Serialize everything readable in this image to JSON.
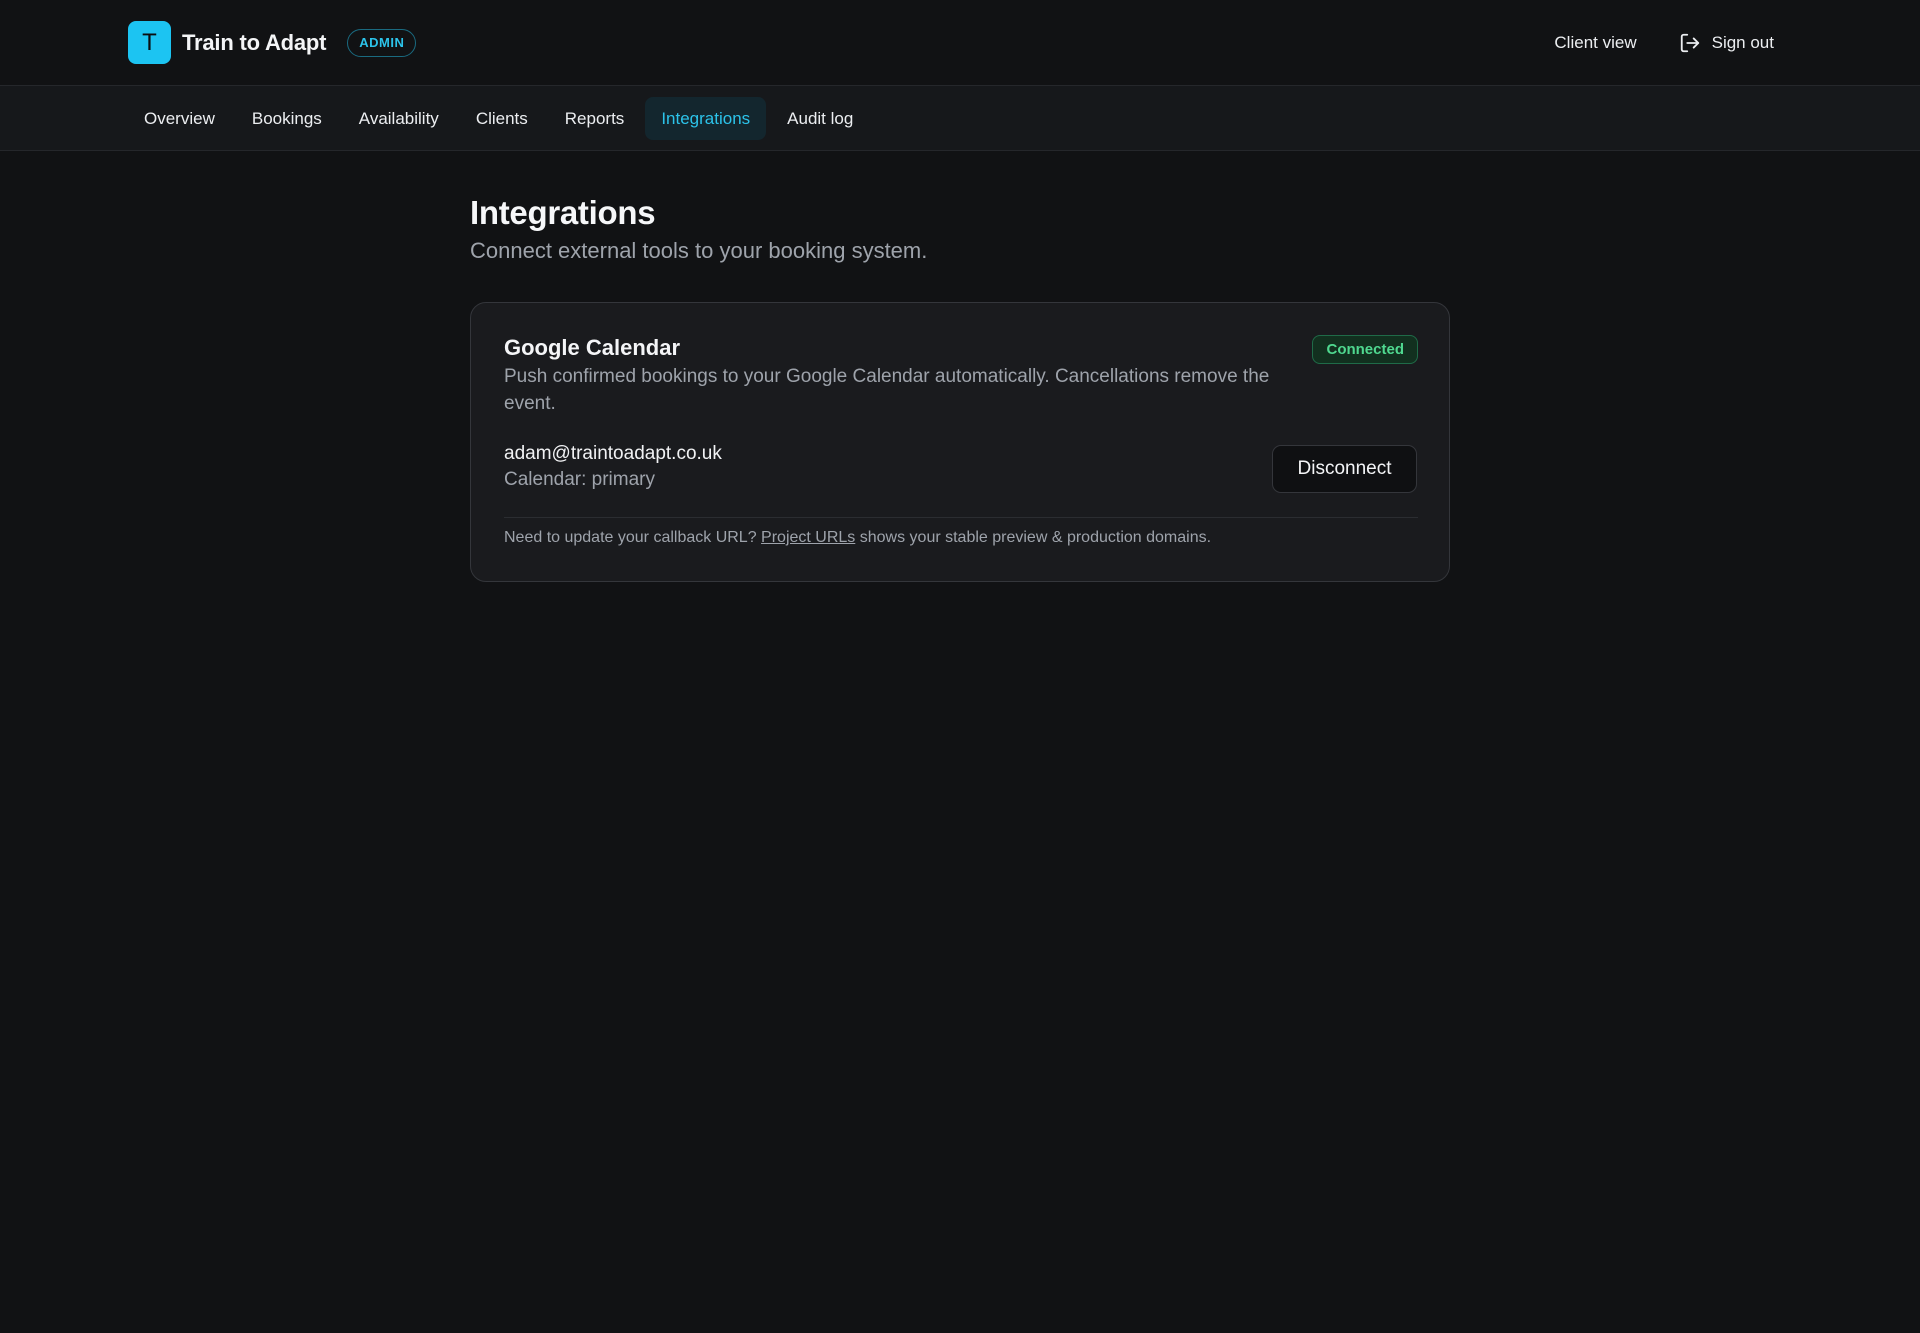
{
  "header": {
    "logo_letter": "T",
    "brand_name": "Train to Adapt",
    "role_badge": "ADMIN",
    "client_view": "Client view",
    "sign_out": "Sign out"
  },
  "nav": {
    "tabs": [
      {
        "label": "Overview"
      },
      {
        "label": "Bookings"
      },
      {
        "label": "Availability"
      },
      {
        "label": "Clients"
      },
      {
        "label": "Reports"
      },
      {
        "label": "Integrations"
      },
      {
        "label": "Audit log"
      }
    ],
    "active": "Integrations"
  },
  "page": {
    "title": "Integrations",
    "subtitle": "Connect external tools to your booking system."
  },
  "integration": {
    "name": "Google Calendar",
    "description": "Push confirmed bookings to your Google Calendar automatically. Cancellations remove the event.",
    "status": "Connected",
    "account_email": "adam@traintoadapt.co.uk",
    "calendar": "Calendar: primary",
    "disconnect_label": "Disconnect",
    "footnote_before": "Need to update your callback URL? ",
    "footnote_link": "Project URLs",
    "footnote_after": " shows your stable preview & production domains."
  },
  "colors": {
    "accent": "#1cc4f2",
    "background": "#111214",
    "status_green": "#4fd88f"
  },
  "icons": {
    "sign_out": "sign-out-icon"
  }
}
